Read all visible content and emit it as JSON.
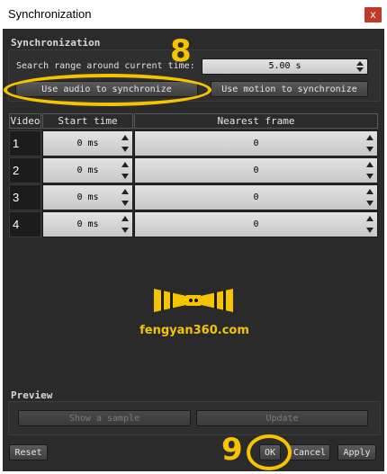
{
  "window": {
    "title": "Synchronization",
    "close_label": "x"
  },
  "sync": {
    "section_label": "Synchronization",
    "search_range_label": "Search range around current time:",
    "search_range_value": "5.00 s",
    "use_audio_label": "Use audio to synchronize",
    "use_motion_label": "Use motion to synchronize"
  },
  "table": {
    "headers": [
      "Video",
      "Start time",
      "Nearest frame"
    ],
    "rows": [
      {
        "video": "1",
        "start_time": "0 ms",
        "nearest_frame": "0"
      },
      {
        "video": "2",
        "start_time": "0 ms",
        "nearest_frame": "0"
      },
      {
        "video": "3",
        "start_time": "0 ms",
        "nearest_frame": "0"
      },
      {
        "video": "4",
        "start_time": "0 ms",
        "nearest_frame": "0"
      }
    ]
  },
  "watermark": {
    "text": "fengyan360.com"
  },
  "preview": {
    "section_label": "Preview",
    "show_sample_label": "Show a sample",
    "update_label": "Update"
  },
  "footer": {
    "reset_label": "Reset",
    "ok_label": "OK",
    "cancel_label": "Cancel",
    "apply_label": "Apply"
  },
  "annotations": {
    "mark_audio": "8",
    "mark_ok": "9"
  },
  "colors": {
    "annotation": "#f4c400",
    "panel": "#2b2b2b",
    "close_button": "#c0392b"
  }
}
